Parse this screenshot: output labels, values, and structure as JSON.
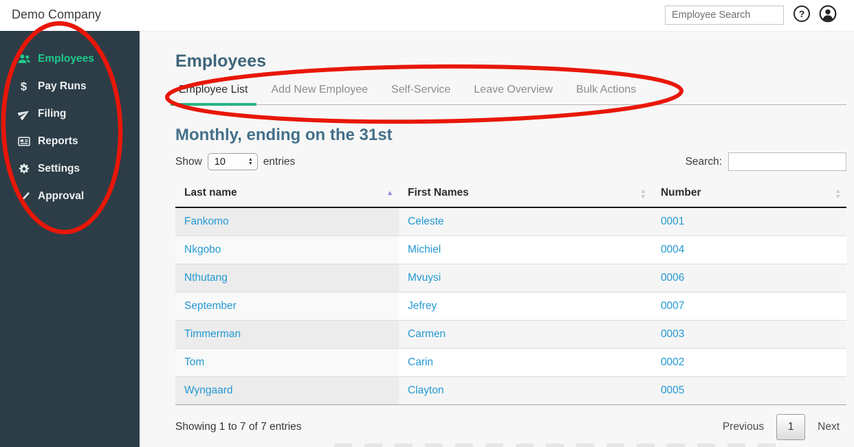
{
  "topbar": {
    "company_name": "Demo Company",
    "search_placeholder": "Employee Search",
    "help_glyph": "?"
  },
  "sidebar": {
    "items": [
      {
        "label": "Employees",
        "icon": "users-icon",
        "active": true
      },
      {
        "label": "Pay Runs",
        "icon": "dollar-icon",
        "active": false
      },
      {
        "label": "Filing",
        "icon": "paper-plane-icon",
        "active": false
      },
      {
        "label": "Reports",
        "icon": "newspaper-icon",
        "active": false
      },
      {
        "label": "Settings",
        "icon": "gear-icon",
        "active": false
      },
      {
        "label": "Approval",
        "icon": "check-icon",
        "active": false
      }
    ]
  },
  "main": {
    "page_title": "Employees",
    "tabs": [
      {
        "label": "Employee List",
        "active": true
      },
      {
        "label": "Add New Employee",
        "active": false
      },
      {
        "label": "Self-Service",
        "active": false
      },
      {
        "label": "Leave Overview",
        "active": false
      },
      {
        "label": "Bulk Actions",
        "active": false
      }
    ],
    "section_title": "Monthly, ending on the 31st",
    "controls": {
      "show_label": "Show",
      "page_size": "10",
      "entries_label": "entries",
      "search_label": "Search:",
      "search_value": ""
    },
    "table": {
      "columns": [
        {
          "label": "Last name",
          "sort": "asc"
        },
        {
          "label": "First Names",
          "sort": "none"
        },
        {
          "label": "Number",
          "sort": "none"
        }
      ],
      "rows": [
        {
          "last_name": "Fankomo",
          "first_names": "Celeste",
          "number": "0001"
        },
        {
          "last_name": "Nkgobo",
          "first_names": "Michiel",
          "number": "0004"
        },
        {
          "last_name": "Nthutang",
          "first_names": "Mvuysi",
          "number": "0006"
        },
        {
          "last_name": "September",
          "first_names": "Jefrey",
          "number": "0007"
        },
        {
          "last_name": "Timmerman",
          "first_names": "Carmen",
          "number": "0003"
        },
        {
          "last_name": "Tom",
          "first_names": "Carin",
          "number": "0002"
        },
        {
          "last_name": "Wyngaard",
          "first_names": "Clayton",
          "number": "0005"
        }
      ]
    },
    "pagination": {
      "summary": "Showing 1 to 7 of 7 entries",
      "previous_label": "Previous",
      "current_page": "1",
      "next_label": "Next"
    }
  },
  "glyphs": {
    "up_triangle": "▲",
    "down_triangle": "▼"
  },
  "annotations": {
    "color": "#e81709"
  },
  "colors": {
    "sidebar_bg": "#2c3d47",
    "active_green": "#1fc98a",
    "tab_underline_green": "#2ab381",
    "link_blue": "#2499d3",
    "heading_slate": "#3e6579",
    "sort_arrow_purple": "#8585df"
  }
}
